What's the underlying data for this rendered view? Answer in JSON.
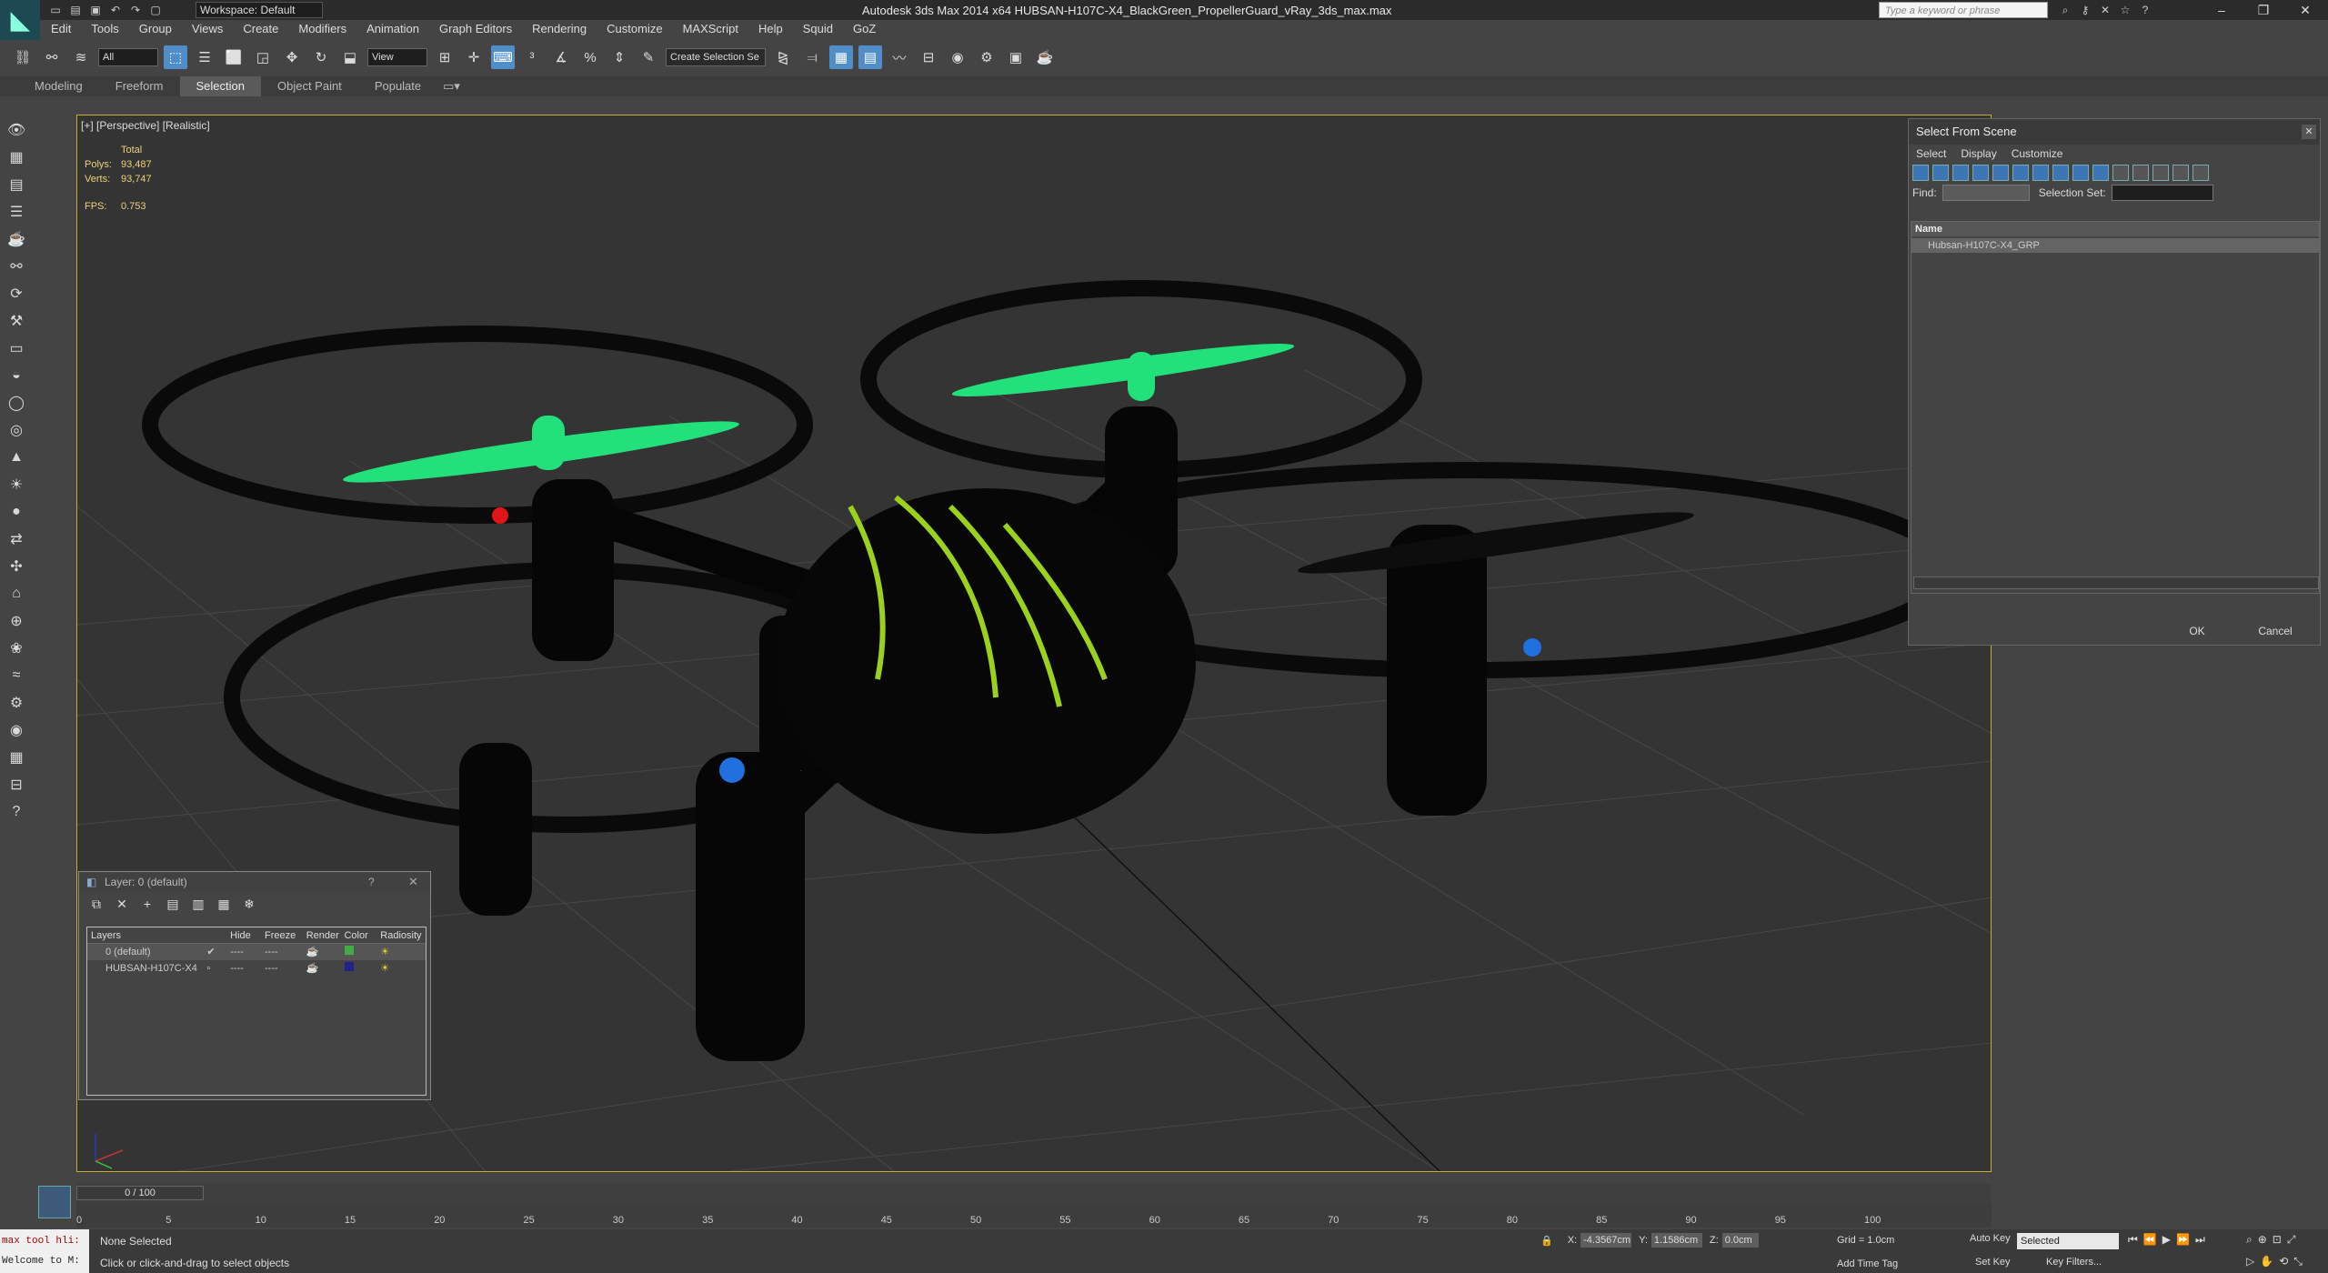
{
  "app": {
    "title": "Autodesk 3ds Max  2014 x64     HUBSAN-H107C-X4_BlackGreen_PropellerGuard_vRay_3ds_max.max",
    "workspace": "Workspace: Default",
    "search_placeholder": "Type a keyword or phrase"
  },
  "menu": [
    "Edit",
    "Tools",
    "Group",
    "Views",
    "Create",
    "Modifiers",
    "Animation",
    "Graph Editors",
    "Rendering",
    "Customize",
    "MAXScript",
    "Help",
    "Squid",
    "GoZ"
  ],
  "toolbar": {
    "filter": "All",
    "ref_coord": "View",
    "named_selection": "Create Selection Se"
  },
  "ribbon_tabs": [
    "Modeling",
    "Freeform",
    "Selection",
    "Object Paint",
    "Populate"
  ],
  "viewport": {
    "label": "[+] [Perspective] [Realistic]",
    "stats": {
      "header": "Total",
      "polys_label": "Polys:",
      "polys": "93,487",
      "verts_label": "Verts:",
      "verts": "93,747",
      "fps_label": "FPS:",
      "fps": "0.753"
    }
  },
  "select_from_scene": {
    "title": "Select From Scene",
    "menu": [
      "Select",
      "Display",
      "Customize"
    ],
    "find_label": "Find:",
    "selection_set_label": "Selection Set:",
    "column_name": "Name",
    "item": "Hubsan-H107C-X4_GRP",
    "ok": "OK",
    "cancel": "Cancel"
  },
  "layer_window": {
    "title": "Layer: 0 (default)",
    "help": "?",
    "columns": [
      "Layers",
      "Hide",
      "Freeze",
      "Render",
      "Color",
      "Radiosity"
    ],
    "rows": [
      {
        "name": "0 (default)",
        "hide": "----",
        "freeze": "----",
        "color": "#44aa44"
      },
      {
        "name": "HUBSAN-H107C-X4",
        "hide": "----",
        "freeze": "----",
        "color": "#222288"
      }
    ]
  },
  "timeline": {
    "frame": "0 / 100",
    "ticks": [
      "0",
      "5",
      "10",
      "15",
      "20",
      "25",
      "30",
      "35",
      "40",
      "45",
      "50",
      "55",
      "60",
      "65",
      "70",
      "75",
      "80",
      "85",
      "90",
      "95",
      "100"
    ]
  },
  "status": {
    "maxscript_lines": [
      "max tool hli:",
      "Welcome to M:"
    ],
    "selection": "None Selected",
    "prompt": "Click or click-and-drag to select objects",
    "x_label": "X:",
    "x": "-4.3567cm",
    "y_label": "Y:",
    "y": "1.1586cm",
    "z_label": "Z:",
    "z": "0.0cm",
    "grid": "Grid = 1.0cm",
    "add_time_tag": "Add Time Tag",
    "auto_key": "Auto Key",
    "set_key": "Set Key",
    "key_mode": "Selected",
    "key_filters": "Key Filters..."
  },
  "colors": {
    "propeller": "#22e07a",
    "accent_select": "#4f8ec9",
    "viewport_border": "#c8aa3b"
  }
}
